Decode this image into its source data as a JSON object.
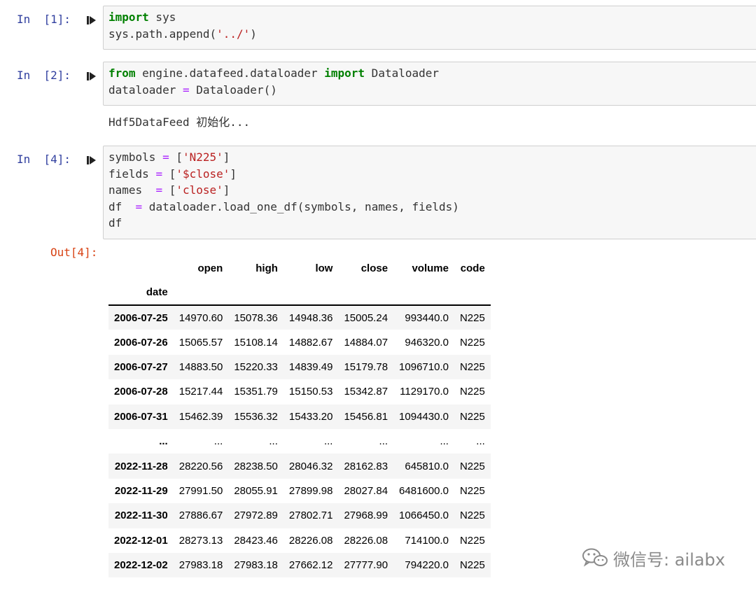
{
  "cells": [
    {
      "prompt": "In  [1]:",
      "lines": [
        [
          {
            "t": "import",
            "c": "kw"
          },
          {
            "t": " sys",
            "c": ""
          }
        ],
        [
          {
            "t": "sys.path.append(",
            "c": ""
          },
          {
            "t": "'../'",
            "c": "str"
          },
          {
            "t": ")",
            "c": ""
          }
        ]
      ]
    },
    {
      "prompt": "In  [2]:",
      "lines": [
        [
          {
            "t": "from",
            "c": "kw"
          },
          {
            "t": " engine.datafeed.dataloader ",
            "c": ""
          },
          {
            "t": "import",
            "c": "kw"
          },
          {
            "t": " Dataloader",
            "c": ""
          }
        ],
        [
          {
            "t": "dataloader ",
            "c": ""
          },
          {
            "t": "=",
            "c": "op"
          },
          {
            "t": " Dataloader()",
            "c": ""
          }
        ]
      ],
      "stream": "Hdf5DataFeed 初始化..."
    },
    {
      "prompt": "In  [4]:",
      "lines": [
        [
          {
            "t": "symbols ",
            "c": ""
          },
          {
            "t": "=",
            "c": "op"
          },
          {
            "t": " [",
            "c": ""
          },
          {
            "t": "'N225'",
            "c": "str"
          },
          {
            "t": "]",
            "c": ""
          }
        ],
        [
          {
            "t": "fields ",
            "c": ""
          },
          {
            "t": "=",
            "c": "op"
          },
          {
            "t": " [",
            "c": ""
          },
          {
            "t": "'$close'",
            "c": "str"
          },
          {
            "t": "]",
            "c": ""
          }
        ],
        [
          {
            "t": "names  ",
            "c": ""
          },
          {
            "t": "=",
            "c": "op"
          },
          {
            "t": " [",
            "c": ""
          },
          {
            "t": "'close'",
            "c": "str"
          },
          {
            "t": "]",
            "c": ""
          }
        ],
        [
          {
            "t": "df  ",
            "c": ""
          },
          {
            "t": "=",
            "c": "op"
          },
          {
            "t": " dataloader.load_one_df(symbols, names, fields)",
            "c": ""
          }
        ],
        [
          {
            "t": "df",
            "c": ""
          }
        ]
      ],
      "out_prompt": "Out[4]:"
    }
  ],
  "dataframe": {
    "columns": [
      "open",
      "high",
      "low",
      "close",
      "volume",
      "code"
    ],
    "index_name": "date",
    "rows": [
      {
        "index": "2006-07-25",
        "values": [
          "14970.60",
          "15078.36",
          "14948.36",
          "15005.24",
          "993440.0",
          "N225"
        ]
      },
      {
        "index": "2006-07-26",
        "values": [
          "15065.57",
          "15108.14",
          "14882.67",
          "14884.07",
          "946320.0",
          "N225"
        ]
      },
      {
        "index": "2006-07-27",
        "values": [
          "14883.50",
          "15220.33",
          "14839.49",
          "15179.78",
          "1096710.0",
          "N225"
        ]
      },
      {
        "index": "2006-07-28",
        "values": [
          "15217.44",
          "15351.79",
          "15150.53",
          "15342.87",
          "1129170.0",
          "N225"
        ]
      },
      {
        "index": "2006-07-31",
        "values": [
          "15462.39",
          "15536.32",
          "15433.20",
          "15456.81",
          "1094430.0",
          "N225"
        ]
      },
      {
        "index": "...",
        "values": [
          "...",
          "...",
          "...",
          "...",
          "...",
          "..."
        ]
      },
      {
        "index": "2022-11-28",
        "values": [
          "28220.56",
          "28238.50",
          "28046.32",
          "28162.83",
          "645810.0",
          "N225"
        ]
      },
      {
        "index": "2022-11-29",
        "values": [
          "27991.50",
          "28055.91",
          "27899.98",
          "28027.84",
          "6481600.0",
          "N225"
        ]
      },
      {
        "index": "2022-11-30",
        "values": [
          "27886.67",
          "27972.89",
          "27802.71",
          "27968.99",
          "1066450.0",
          "N225"
        ]
      },
      {
        "index": "2022-12-01",
        "values": [
          "28273.13",
          "28423.46",
          "28226.08",
          "28226.08",
          "714100.0",
          "N225"
        ]
      },
      {
        "index": "2022-12-02",
        "values": [
          "27983.18",
          "27983.18",
          "27662.12",
          "27777.90",
          "794220.0",
          "N225"
        ]
      }
    ]
  },
  "watermark": {
    "text": "微信号: ailabx",
    "icon": "wechat-icon"
  },
  "colors": {
    "in_prompt": "#303f9f",
    "out_prompt": "#d84315",
    "keyword": "#008000",
    "string": "#ba2121",
    "operator": "#aa22ff"
  }
}
